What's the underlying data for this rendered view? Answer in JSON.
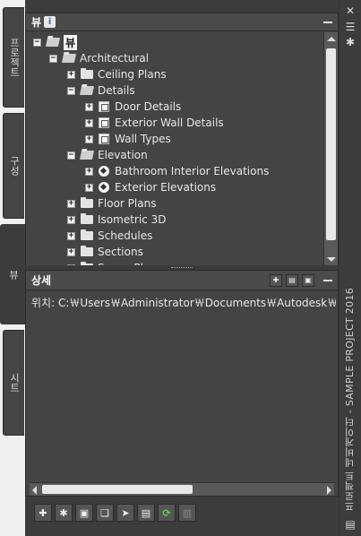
{
  "window": {
    "title": "프로젝트 네비게이터 - SAMPLE PROJECT 2016",
    "close_glyph": "✕",
    "menu_glyph": "☰",
    "pin_glyph": "✱"
  },
  "side_tabs": [
    "프로젝트",
    "구성",
    "뷰",
    "시트"
  ],
  "views_panel": {
    "title": "뷰",
    "info_badge": "i",
    "tree": [
      {
        "label": "뷰",
        "level": 0,
        "type": "root",
        "expander": "−"
      },
      {
        "label": "Architectural",
        "level": 1,
        "type": "folder-open",
        "expander": "−"
      },
      {
        "label": "Ceiling Plans",
        "level": 2,
        "type": "folder",
        "expander": "+"
      },
      {
        "label": "Details",
        "level": 2,
        "type": "folder-open",
        "expander": "−"
      },
      {
        "label": "Door Details",
        "level": 3,
        "type": "view",
        "expander": "+"
      },
      {
        "label": "Exterior Wall Details",
        "level": 3,
        "type": "view",
        "expander": "+"
      },
      {
        "label": "Wall Types",
        "level": 3,
        "type": "view",
        "expander": "+"
      },
      {
        "label": "Elevation",
        "level": 2,
        "type": "folder-open",
        "expander": "−"
      },
      {
        "label": "Bathroom Interior Elevations",
        "level": 3,
        "type": "elevation",
        "expander": "+"
      },
      {
        "label": "Exterior Elevations",
        "level": 3,
        "type": "elevation",
        "expander": "+"
      },
      {
        "label": "Floor Plans",
        "level": 2,
        "type": "folder",
        "expander": "+"
      },
      {
        "label": "Isometric 3D",
        "level": 2,
        "type": "folder",
        "expander": "+"
      },
      {
        "label": "Schedules",
        "level": 2,
        "type": "folder",
        "expander": "+"
      },
      {
        "label": "Sections",
        "level": 2,
        "type": "folder",
        "expander": "+"
      },
      {
        "label": "Space Plans",
        "level": 2,
        "type": "folder",
        "expander": "+"
      }
    ]
  },
  "details_panel": {
    "title": "상세",
    "location_text": "위치: C:￦Users￦Administrator￦Documents￦Autodesk￦내 프"
  },
  "toolbar_buttons": [
    {
      "name": "new-view-button",
      "glyph": "✚"
    },
    {
      "name": "new-detail-button",
      "glyph": "✱"
    },
    {
      "name": "view-properties-button",
      "glyph": "▣"
    },
    {
      "name": "clipboard-button",
      "glyph": "❏"
    },
    {
      "name": "select-button",
      "glyph": "➤"
    },
    {
      "name": "table-button",
      "glyph": "▤"
    },
    {
      "name": "refresh-button",
      "glyph": "⟳"
    },
    {
      "name": "archive-button",
      "glyph": "▥"
    }
  ],
  "colors": {
    "panel_bg": "#444444",
    "frame_bg": "#3c3c3c",
    "text": "#e8e8e8",
    "refresh_green": "#5fd24f"
  }
}
